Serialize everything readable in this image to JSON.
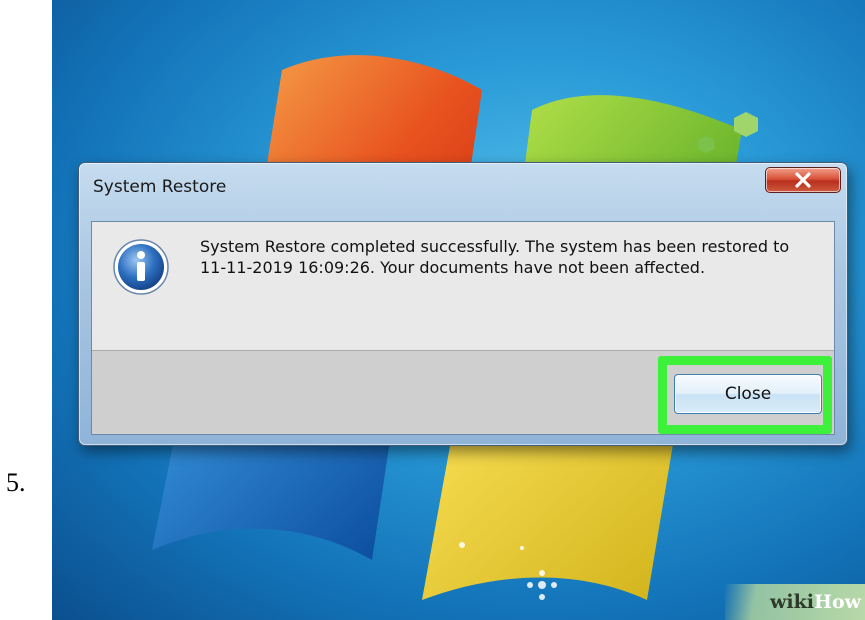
{
  "step": {
    "number": "5."
  },
  "dialog": {
    "title": "System Restore",
    "icon": "info-icon",
    "message": "System Restore completed successfully. The system has been restored to 11-11-2019 16:09:26. Your documents have not been affected.",
    "close_button_label": "Close",
    "highlight_color": "#3df03a"
  },
  "watermark": {
    "wiki": "wiki",
    "how": "How"
  },
  "colors": {
    "desktop_blue": "#2a9bd8",
    "close_x_red": "#d9523a"
  }
}
